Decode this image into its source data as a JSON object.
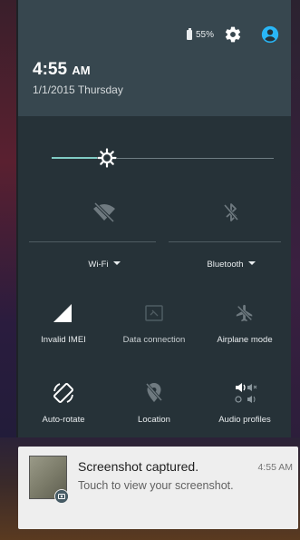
{
  "status": {
    "battery_percent": "55%"
  },
  "header": {
    "time": "4:55",
    "ampm": "AM",
    "date": "1/1/2015 Thursday"
  },
  "brightness": {
    "level": 0.25
  },
  "tiles": {
    "wifi": {
      "label": "Wi-Fi",
      "icon": "wifi-off-icon",
      "state": "off"
    },
    "bluetooth": {
      "label": "Bluetooth",
      "icon": "bluetooth-off-icon",
      "state": "off"
    },
    "invalid_imei": {
      "label": "Invalid IMEI",
      "icon": "signal-icon"
    },
    "data_connection": {
      "label": "Data connection",
      "icon": "data-connection-icon",
      "state": "off"
    },
    "airplane_mode": {
      "label": "Airplane mode",
      "icon": "airplane-icon",
      "state": "off"
    },
    "auto_rotate": {
      "label": "Auto-rotate",
      "icon": "rotate-icon",
      "state": "on"
    },
    "location": {
      "label": "Location",
      "icon": "location-off-icon",
      "state": "off"
    },
    "audio_profiles": {
      "label": "Audio profiles",
      "icon": "audio-profiles-icon"
    }
  },
  "notification": {
    "title": "Screenshot captured.",
    "time": "4:55 AM",
    "body": "Touch to view your screenshot."
  },
  "colors": {
    "shade": "#263238",
    "header": "#37474f",
    "accent": "#80cbc4",
    "avatar": "#29b6f6"
  }
}
